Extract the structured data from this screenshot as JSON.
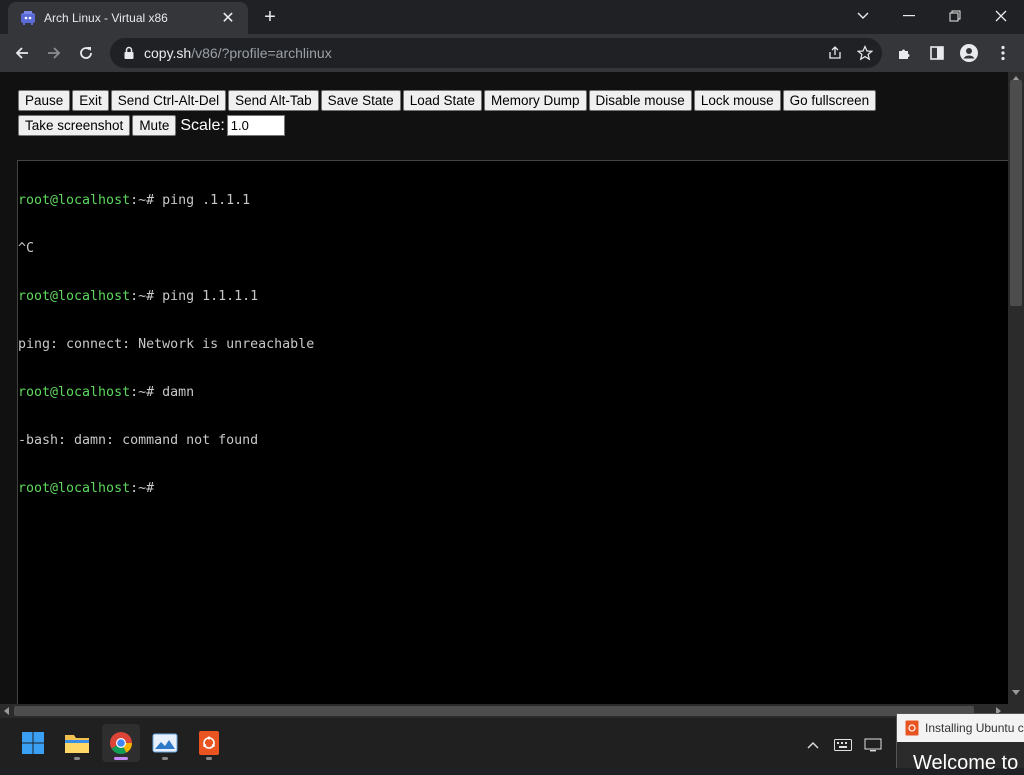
{
  "browser": {
    "tab_title": "Arch Linux - Virtual x86",
    "url_host": "copy.sh",
    "url_path": "/v86/?profile=archlinux"
  },
  "controls": {
    "buttons": [
      "Pause",
      "Exit",
      "Send Ctrl-Alt-Del",
      "Send Alt-Tab",
      "Save State",
      "Load State",
      "Memory Dump",
      "Disable mouse",
      "Lock mouse",
      "Go fullscreen",
      "Take screenshot",
      "Mute"
    ],
    "scale_label": "Scale:",
    "scale_value": "1.0"
  },
  "terminal": {
    "lines": [
      {
        "user": "root@localhost",
        "path": ":~# ",
        "cmd": "ping .1.1.1"
      },
      {
        "text": "^C"
      },
      {
        "user": "root@localhost",
        "path": ":~# ",
        "cmd": "ping 1.1.1.1"
      },
      {
        "text": "ping: connect: Network is unreachable"
      },
      {
        "user": "root@localhost",
        "path": ":~# ",
        "cmd": "damn"
      },
      {
        "text": "-bash: damn: command not found"
      },
      {
        "user": "root@localhost",
        "path": ":~# ",
        "cmd": ""
      }
    ]
  },
  "taskbar": {
    "apps": [
      "start-icon",
      "file-explorer-icon",
      "chrome-icon",
      "photos-icon",
      "ubuntu-installer-icon"
    ]
  },
  "notification": {
    "title": "Installing Ubuntu c",
    "body": "Welcome to"
  },
  "colors": {
    "prompt_green": "#5fd75f",
    "terminal_bg": "#000000",
    "page_bg": "#111111"
  }
}
